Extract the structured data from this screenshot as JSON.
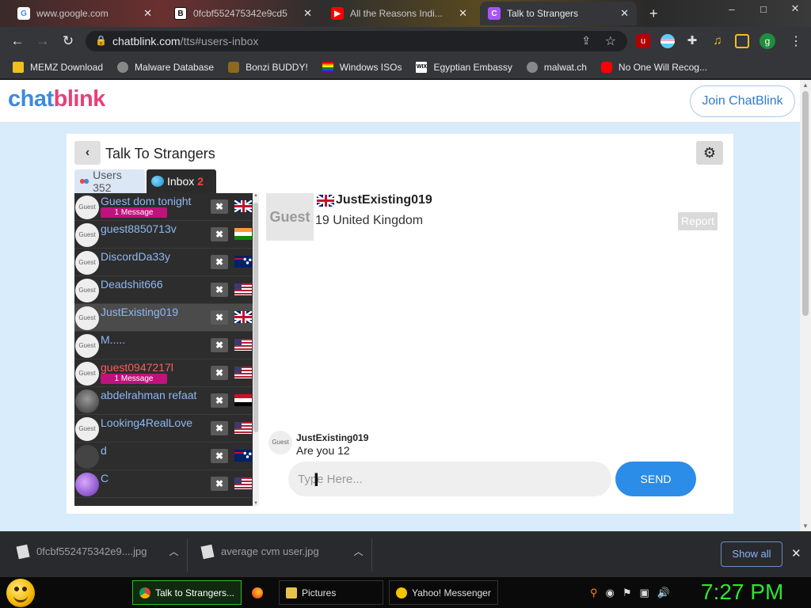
{
  "browser": {
    "tabs": [
      {
        "label": "www.google.com",
        "favicon": "google-icon"
      },
      {
        "label": "0fcbf552475342e9cd5",
        "favicon": "bing-icon"
      },
      {
        "label": "All the Reasons Indi...",
        "favicon": "youtube-icon"
      },
      {
        "label": "Talk to Strangers",
        "favicon": "chatblink-icon",
        "active": true
      }
    ],
    "window_controls": [
      "–",
      "□",
      "✕"
    ],
    "url_host": "chatblink.com",
    "url_path": "/tts#users-inbox",
    "profile_initial": "g",
    "bookmarks": [
      {
        "label": "MEMZ Download",
        "icon": "globe-icon"
      },
      {
        "label": "Malware Database",
        "icon": "globe-icon"
      },
      {
        "label": "Bonzi BUDDY!",
        "icon": "bonzi-icon"
      },
      {
        "label": "Windows ISOs",
        "icon": "windows-icon"
      },
      {
        "label": "Egyptian Embassy",
        "icon": "wix-icon"
      },
      {
        "label": "malwat.ch",
        "icon": "globe-icon"
      },
      {
        "label": "No One Will Recog...",
        "icon": "youtube-icon"
      }
    ]
  },
  "site": {
    "logo_part1": "chat",
    "logo_part2": "blink",
    "join_label": "Join ChatBlink"
  },
  "panel": {
    "title": "Talk To Strangers",
    "tab_users_label": "Users 352",
    "tab_inbox_label": "Inbox",
    "tab_inbox_count": "2"
  },
  "users": [
    {
      "name": "Guest dom tonight",
      "avatar": "Guest",
      "badge": "1 Message",
      "flag": "uk",
      "red": false
    },
    {
      "name": "guest8850713v",
      "avatar": "Guest",
      "badge": "",
      "flag": "in",
      "red": false
    },
    {
      "name": "DiscordDa33y",
      "avatar": "Guest",
      "badge": "",
      "flag": "au",
      "red": false
    },
    {
      "name": "Deadshit666",
      "avatar": "Guest",
      "badge": "",
      "flag": "us",
      "red": false
    },
    {
      "name": "JustExisting019",
      "avatar": "Guest",
      "badge": "",
      "flag": "uk",
      "red": false,
      "selected": true
    },
    {
      "name": "M.....",
      "avatar": "Guest",
      "badge": "",
      "flag": "us",
      "red": false
    },
    {
      "name": "guest0947217l",
      "avatar": "Guest",
      "badge": "1 Message",
      "flag": "us",
      "red": true
    },
    {
      "name": "abdelrahman refaat",
      "avatar": "",
      "badge": "",
      "flag": "eg",
      "red": false,
      "avatar_style": "photo"
    },
    {
      "name": "Looking4RealLove",
      "avatar": "Guest",
      "badge": "",
      "flag": "us",
      "red": false
    },
    {
      "name": "d",
      "avatar": "",
      "badge": "",
      "flag": "au",
      "red": false,
      "avatar_style": "dark"
    },
    {
      "name": "C",
      "avatar": "",
      "badge": "",
      "flag": "us",
      "red": false,
      "avatar_style": "gem"
    }
  ],
  "profile": {
    "avatar_label": "Guest",
    "name": "JustExisting019",
    "info": "19 United Kingdom",
    "report_label": "Report"
  },
  "chat": {
    "sender_avatar": "Guest",
    "sender": "JustExisting019",
    "message": "Are you 12",
    "input_placeholder": "Type Here...",
    "send_label": "SEND"
  },
  "downloads": {
    "items": [
      {
        "name": "0fcbf552475342e9....jpg"
      },
      {
        "name": "average cvm user.jpg"
      }
    ],
    "show_all_label": "Show all"
  },
  "taskbar": {
    "items": [
      {
        "label": "Talk to Strangers...",
        "icon": "chrome-icon",
        "active": true
      },
      {
        "label": "",
        "icon": "firefox-icon"
      },
      {
        "label": "Pictures",
        "icon": "folder-icon"
      },
      {
        "label": "Yahoo! Messenger",
        "icon": "yahoo-messenger-icon"
      }
    ],
    "clock": "7:27 PM"
  }
}
